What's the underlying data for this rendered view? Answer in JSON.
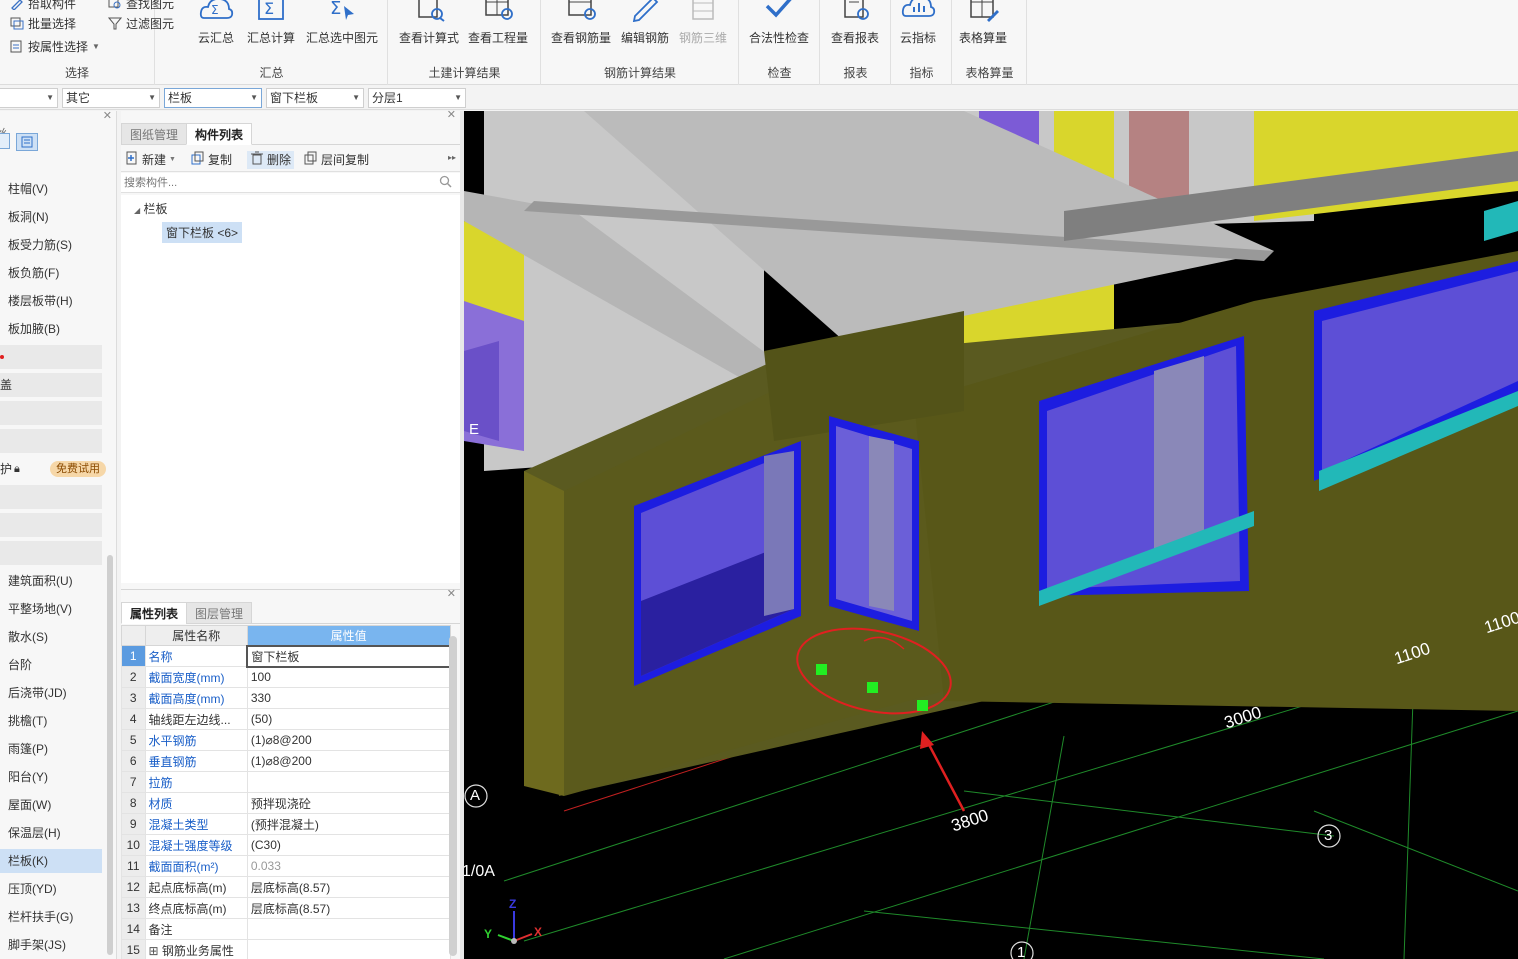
{
  "ribbon": {
    "select_group": {
      "title": "选择",
      "pick_component": "拾取构件",
      "batch_select": "批量选择",
      "select_by_attribute": "按属性选择",
      "find_element": "查找图元",
      "filter_element": "过滤图元"
    },
    "summary_group": {
      "title": "汇总",
      "cloud_summary": "云汇总",
      "summary_calc": "汇总计算",
      "summary_selected": "汇总选中图元"
    },
    "civil_group": {
      "title": "土建计算结果",
      "view_formula": "查看计算式",
      "view_quantity": "查看工程量"
    },
    "rebar_group": {
      "title": "钢筋计算结果",
      "view_rebar_qty": "查看钢筋量",
      "edit_rebar": "编辑钢筋",
      "rebar_3d": "钢筋三维"
    },
    "check_group": {
      "title": "检查",
      "legality_check": "合法性检查"
    },
    "report_group": {
      "title": "报表",
      "view_report": "查看报表"
    },
    "index_group": {
      "title": "指标",
      "cloud_index": "云指标"
    },
    "table_group": {
      "title": "表格算量",
      "table_calc": "表格算量"
    }
  },
  "filterbar": {
    "combo1": "",
    "combo2": "其它",
    "combo3": "栏板",
    "combo4": "窗下栏板",
    "combo5": "分层1"
  },
  "leftnav": {
    "header": "丝",
    "items_top": [
      "柱帽(V)",
      "板洞(N)",
      "板受力筋(S)",
      "板负筋(F)",
      "楼层板带(H)",
      "板加腋(B)"
    ],
    "cover_label": "盖",
    "protect_label": "护",
    "trial_badge": "免费试用",
    "items_bottom": [
      "建筑面积(U)",
      "平整场地(V)",
      "散水(S)",
      "台阶",
      "后浇带(JD)",
      "挑檐(T)",
      "雨篷(P)",
      "阳台(Y)",
      "屋面(W)",
      "保温层(H)",
      "栏板(K)",
      "压顶(YD)",
      "栏杆扶手(G)",
      "脚手架(JS)"
    ]
  },
  "midpanel": {
    "tab_drawings": "图纸管理",
    "tab_components": "构件列表",
    "new_btn": "新建",
    "copy_btn": "复制",
    "delete_btn": "删除",
    "floor_copy_btn": "层间复制",
    "search_placeholder": "搜索构件...",
    "tree_root": "栏板",
    "tree_child": "窗下栏板 <6>",
    "tab_props": "属性列表",
    "tab_layers": "图层管理",
    "col_name": "属性名称",
    "col_value": "属性值",
    "props": [
      {
        "n": "1",
        "name": "名称",
        "value": "窗下栏板",
        "blue": true
      },
      {
        "n": "2",
        "name": "截面宽度(mm)",
        "value": "100",
        "blue": true
      },
      {
        "n": "3",
        "name": "截面高度(mm)",
        "value": "330",
        "blue": true
      },
      {
        "n": "4",
        "name": "轴线距左边线...",
        "value": "(50)",
        "blue": false
      },
      {
        "n": "5",
        "name": "水平钢筋",
        "value": "(1)⌀8@200",
        "blue": true
      },
      {
        "n": "6",
        "name": "垂直钢筋",
        "value": "(1)⌀8@200",
        "blue": true
      },
      {
        "n": "7",
        "name": "拉筋",
        "value": "",
        "blue": true
      },
      {
        "n": "8",
        "name": "材质",
        "value": "预拌现浇砼",
        "blue": true
      },
      {
        "n": "9",
        "name": "混凝土类型",
        "value": "(预拌混凝土)",
        "blue": true
      },
      {
        "n": "10",
        "name": "混凝土强度等级",
        "value": "(C30)",
        "blue": true
      },
      {
        "n": "11",
        "name": "截面面积(m²)",
        "value": "0.033",
        "blue": true,
        "gray": true
      },
      {
        "n": "12",
        "name": "起点底标高(m)",
        "value": "层底标高(8.57)",
        "blue": false
      },
      {
        "n": "13",
        "name": "终点底标高(m)",
        "value": "层底标高(8.57)",
        "blue": false
      },
      {
        "n": "14",
        "name": "备注",
        "value": "",
        "blue": false
      },
      {
        "n": "15",
        "name": "钢筋业务属性",
        "value": "",
        "blue": false,
        "expand": true
      }
    ]
  },
  "viewport": {
    "dims": [
      "3800",
      "3000",
      "1100",
      "1100"
    ],
    "axis_labels": [
      "E",
      "A",
      "1/0A",
      "3",
      "1"
    ],
    "gizmo": {
      "x": "X",
      "y": "Y",
      "z": "Z"
    }
  }
}
